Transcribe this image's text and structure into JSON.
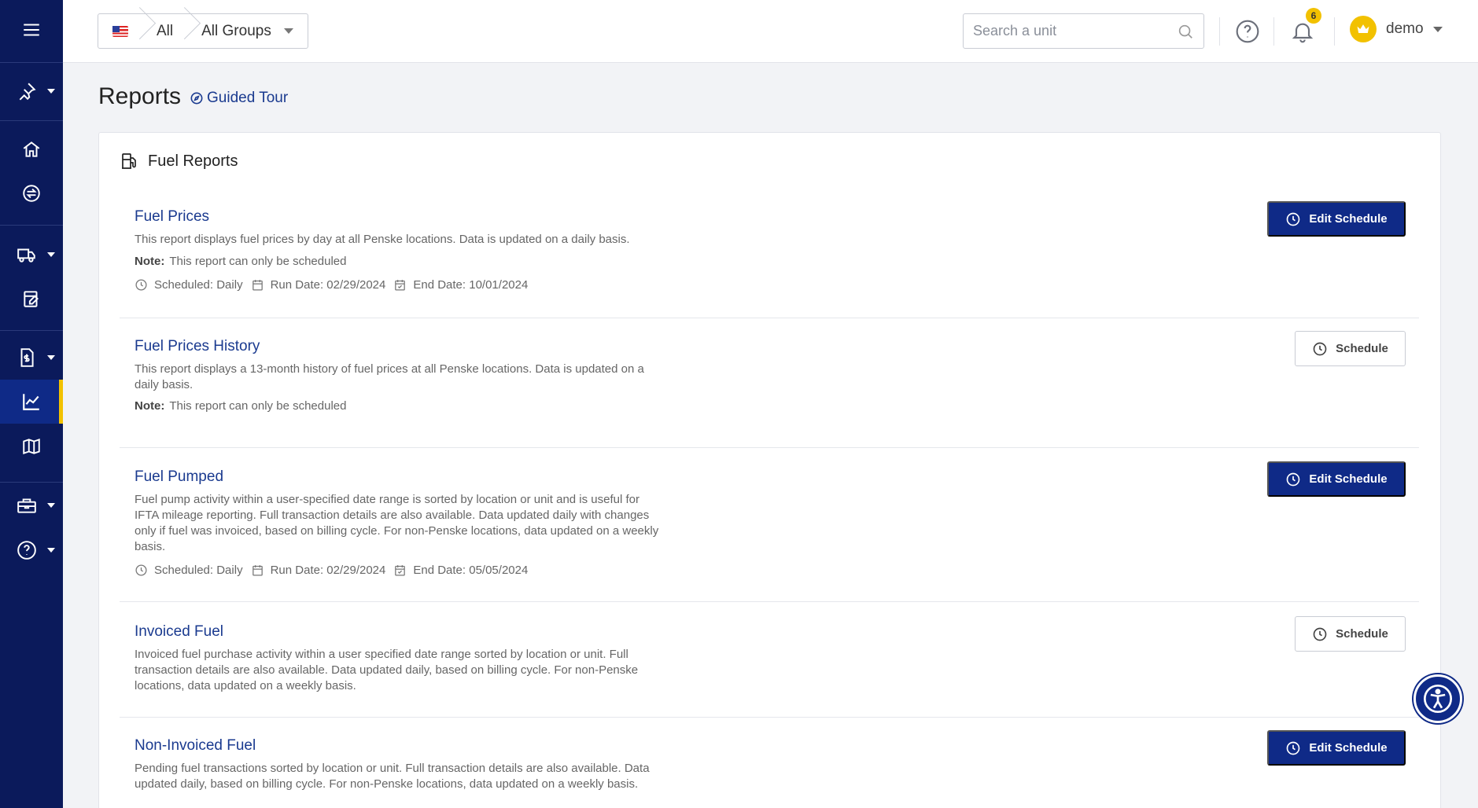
{
  "header": {
    "breadcrumb": {
      "region_flag": "us-flag-icon",
      "level1": "All",
      "level2": "All Groups"
    },
    "search": {
      "placeholder": "Search a unit"
    },
    "notifications": {
      "count": "6"
    },
    "user": {
      "name": "demo"
    }
  },
  "sidebar": {
    "items": [
      {
        "icon": "menu-icon"
      },
      {
        "icon": "pin-icon"
      },
      {
        "icon": "home-icon"
      },
      {
        "icon": "exchange-icon"
      },
      {
        "icon": "truck-icon"
      },
      {
        "icon": "fuel-card-icon"
      },
      {
        "icon": "invoice-icon"
      },
      {
        "icon": "chart-icon",
        "active": true
      },
      {
        "icon": "map-icon"
      },
      {
        "icon": "toolbox-icon"
      },
      {
        "icon": "help-icon"
      }
    ]
  },
  "page": {
    "title": "Reports",
    "guided_tour": "Guided Tour"
  },
  "section": {
    "title": "Fuel Reports",
    "reports": [
      {
        "title": "Fuel Prices",
        "description": "This report displays fuel prices by day at all Penske locations. Data is updated on a daily basis.",
        "note_label": "Note:",
        "note": "This report can only be scheduled",
        "scheduled": "Scheduled: Daily",
        "run_date": "Run Date: 02/29/2024",
        "end_date": "End Date: 10/01/2024",
        "button": "Edit Schedule"
      },
      {
        "title": "Fuel Prices History",
        "description": "This report displays a 13-month history of fuel prices at all Penske locations. Data is updated on a daily basis.",
        "note_label": "Note:",
        "note": "This report can only be scheduled",
        "button": "Schedule"
      },
      {
        "title": "Fuel Pumped",
        "description": "Fuel pump activity within a user-specified date range is sorted by location or unit and is useful for IFTA mileage reporting. Full transaction details are also available. Data updated daily with changes only if fuel was invoiced, based on billing cycle. For non-Penske locations, data updated on a weekly basis.",
        "scheduled": "Scheduled: Daily",
        "run_date": "Run Date: 02/29/2024",
        "end_date": "End Date: 05/05/2024",
        "button": "Edit Schedule"
      },
      {
        "title": "Invoiced Fuel",
        "description": "Invoiced fuel purchase activity within a user specified date range sorted by location or unit. Full transaction details are also available. Data updated daily, based on billing cycle. For non-Penske locations, data updated on a weekly basis.",
        "button": "Schedule"
      },
      {
        "title": "Non-Invoiced Fuel",
        "description": "Pending fuel transactions sorted by location or unit. Full transaction details are also available. Data updated daily, based on billing cycle. For non-Penske locations, data updated on a weekly basis.",
        "button": "Edit Schedule"
      }
    ]
  },
  "colors": {
    "sidebar_bg": "#0b1a5b",
    "primary": "#0f2a87",
    "accent": "#f2c100",
    "link": "#1a3a8f"
  }
}
